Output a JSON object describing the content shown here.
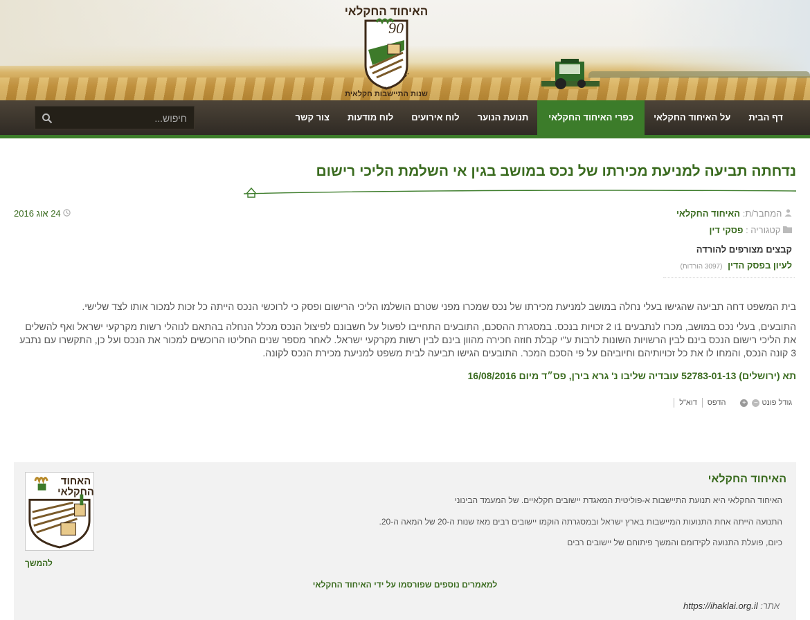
{
  "site": {
    "logo_text": "האיחוד החקלאי",
    "logo_year": "90",
    "logo_sub": "שנות התיישבות חקלאית"
  },
  "nav": {
    "items": [
      {
        "label": "דף הבית"
      },
      {
        "label": "על האיחוד החקלאי"
      },
      {
        "label": "כפרי האיחוד החקלאי",
        "active": true
      },
      {
        "label": "תנועת הנוער"
      },
      {
        "label": "לוח אירועים"
      },
      {
        "label": "לוח מודעות"
      },
      {
        "label": "צור קשר"
      }
    ],
    "search_placeholder": "חיפוש...",
    "active_color": "#3c7c2a"
  },
  "article": {
    "title": "נדחתה תביעה למניעת מכירתו של נכס במושב בגין אי השלמת הליכי רישום",
    "author_label": "המחבר/ת:",
    "author": "האיחוד החקלאי",
    "category_label": "קטגוריה :",
    "category": "פסקי דין",
    "date": "24 אוג 2016",
    "attachments_title": "קבצים מצורפים להורדה",
    "attachment_link": "לעיון בפסק הדין",
    "attachment_downloads": "(3097 הורדות)",
    "paragraph1": "בית המשפט דחה תביעה שהגישו בעלי נחלה במושב למניעת מכירתו של נכס שמכרו מפני שטרם הושלמו הליכי הרישום ופסק כי לרוכשי הנכס הייתה כל זכות למכור אותו לצד שלישי.",
    "paragraph2": "התובעים, בעלי נכס במושב, מכרו לנתבעים 1ו 2 זכויות בנכס. במסגרת ההסכם, התובעים התחייבו לפעול על חשבונם לפיצול הנכס מכלל הנחלה בהתאם לנוהלי רשות מקרקעי ישראל ואף להשלים את הליכי רישום הנכס בינם לבין הרשויות השונות לרבות ע\"י קבלת חוזה חכירה מהוון בינם לבין רשות מקרקעי ישראל. לאחר מספר שנים החליטו הרוכשים למכור את הנכס ועל כן, התקשרו עם נתבע 3 קונה הנכס, והמחו לו את כל זכויותיהם וחיוביהם על פי הסכם המכר. התובעים הגישו תביעה לבית משפט למניעת מכירת הנכס לקונה.",
    "verdict": "תא (ירושלים) 52783-01-13 עובדיה שליבו נ' גרא בירן, פס״ד מיום  16/08/2016"
  },
  "tools": {
    "font_size_label": "גודל פונט",
    "minus": "−",
    "plus": "+",
    "print_label": "הדפס",
    "email_label": "דוא\"ל"
  },
  "author_box": {
    "title": "האיחוד החקלאי",
    "line1": "האיחוד החקלאי היא תנועת התיישבות א-פוליטית המאגדת יישובים חקלאיים. של המעמד הבינוני",
    "line2": "התנועה הייתה אחת התנועות המיישבות בארץ ישראל ובמסגרתה הוקמו יישובים רבים מאז שנות ה-20 של המאה ה-20.",
    "line3": "כיום, פועלת התנועה לקידומם והמשך פיתוחם של יישובים רבים",
    "logo_line1": "האחוד",
    "logo_line2": "החקלאי",
    "more": "להמשך",
    "more_articles": "למאמרים נוספים שפורסמו על ידי האיחוד החקלאי",
    "site_label": "אתר:",
    "site_url": "https://ihaklai.org.il"
  }
}
